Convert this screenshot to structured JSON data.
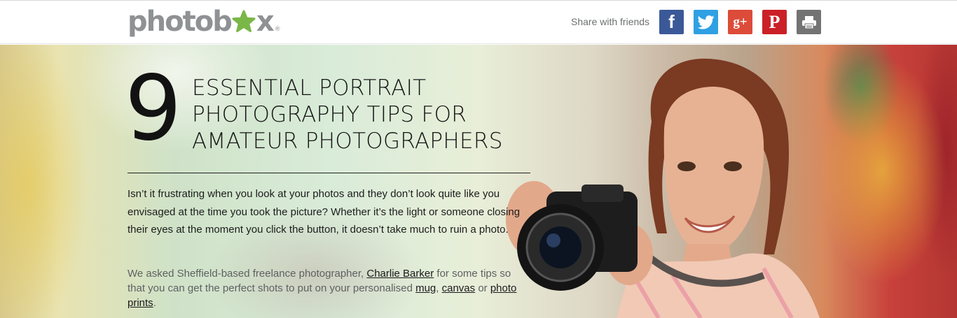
{
  "header": {
    "logo": {
      "left": "photob",
      "right": "x",
      "reg": "®"
    },
    "share_label": "Share with friends",
    "social": [
      {
        "name": "facebook",
        "glyph": "f",
        "color": "#3b5998"
      },
      {
        "name": "twitter",
        "glyph": "twitter-bird",
        "color": "#2fa0e4"
      },
      {
        "name": "google-plus",
        "glyph": "g+",
        "color": "#dd4b39"
      },
      {
        "name": "pinterest",
        "glyph": "P",
        "color": "#cb2027"
      },
      {
        "name": "print",
        "glyph": "printer",
        "color": "#737373"
      }
    ]
  },
  "hero": {
    "number": "9",
    "title_lines": [
      "ESSENTIAL PORTRAIT",
      "PHOTOGRAPHY TIPS FOR",
      "AMATEUR PHOTOGRAPHERS"
    ],
    "intro": "Isn’t it frustrating when you look at your photos and they don’t look quite like you envisaged at the time you took the picture? Whether it’s the light or someone closing their eyes at the moment you click the button, it doesn’t take much to ruin a photo.",
    "p2": {
      "before": "We asked Sheffield-based freelance photographer, ",
      "link_name": "Charlie Barker",
      "mid1": " for some tips so that you can get the perfect shots to put on your personalised ",
      "link_mug": "mug",
      "comma": ", ",
      "link_canvas": "canvas",
      "or": " or ",
      "link_prints": "photo prints",
      "end": "."
    }
  },
  "colors": {
    "accent": "#7ab648",
    "text": "#141414"
  }
}
